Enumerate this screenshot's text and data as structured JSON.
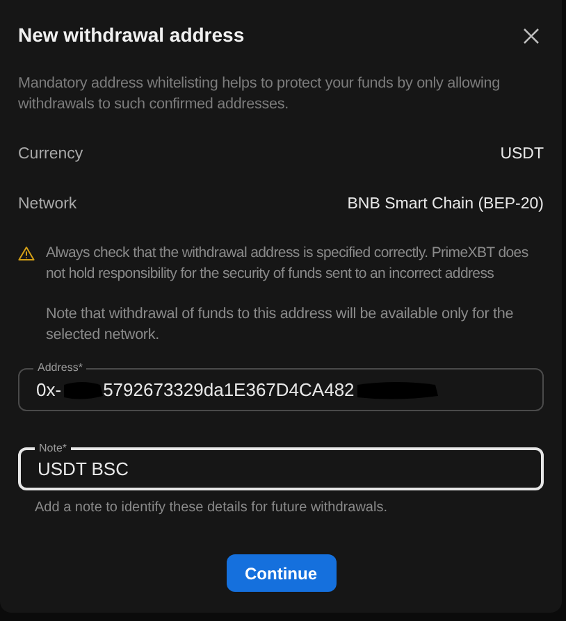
{
  "dialog": {
    "title": "New withdrawal address",
    "description": "Mandatory address whitelisting helps to protect your funds by only allowing withdrawals to such confirmed addresses."
  },
  "details": [
    {
      "label": "Currency",
      "value": "USDT"
    },
    {
      "label": "Network",
      "value": "BNB Smart Chain (BEP-20)"
    }
  ],
  "warning": {
    "text": "Always check that the withdrawal address is specified correctly. PrimeXBT does not hold responsibility for the security of funds sent to an incorrect address",
    "note": "Note that withdrawal of funds to this address will be available only for the selected network."
  },
  "fields": [
    {
      "label": "Address*",
      "value_parts": [
        "0x-",
        "5792673329da1E367D4CA482"
      ],
      "focused": false
    },
    {
      "label": "Note*",
      "value_parts": [
        "USDT BSC"
      ],
      "focused": true,
      "helper": "Add a note to identify these details for future withdrawals."
    }
  ],
  "buttons": [
    {
      "label": "Continue"
    }
  ]
}
